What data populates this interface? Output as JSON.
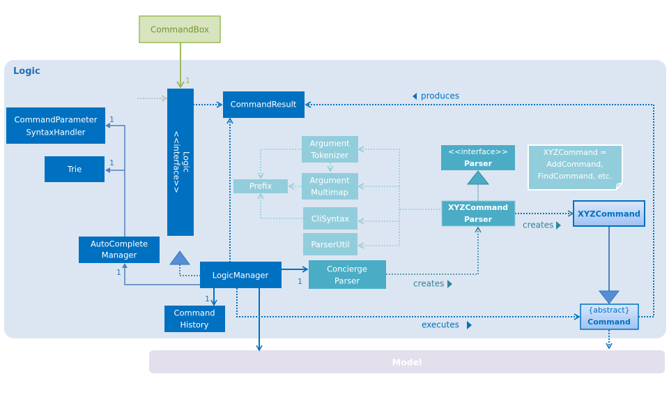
{
  "diagram": {
    "packages": {
      "logic": {
        "label": "Logic",
        "color": "#dce6f2"
      },
      "model": {
        "label": "Model",
        "color": "#e4dfec"
      }
    },
    "external": {
      "command_box": {
        "label": "CommandBox"
      }
    },
    "classes": {
      "command_parameter_syntax_handler": {
        "line1": "CommandParameter",
        "line2": "SyntaxHandler"
      },
      "trie": {
        "label": "Trie"
      },
      "autocomplete_manager": {
        "line1": "AutoComplete",
        "line2": "Manager"
      },
      "logic_interface": {
        "line1": "<<interface>>",
        "line2": "Logic"
      },
      "command_result": {
        "label": "CommandResult"
      },
      "logic_manager": {
        "label": "LogicManager"
      },
      "command_history": {
        "line1": "Command",
        "line2": "History"
      },
      "concierge_parser": {
        "line1": "Concierge",
        "line2": "Parser"
      },
      "argument_tokenizer": {
        "line1": "Argument",
        "line2": "Tokenizer"
      },
      "argument_multimap": {
        "line1": "Argument",
        "line2": "Multimap"
      },
      "prefix": {
        "label": "Prefix"
      },
      "cli_syntax": {
        "label": "CliSyntax"
      },
      "parser_util": {
        "label": "ParserUtil"
      },
      "parser_interface": {
        "line1": "<<interface>>",
        "line2": "Parser"
      },
      "xyz_command_parser": {
        "line1": "XYZCommand",
        "line2": "Parser"
      },
      "xyz_command": {
        "label": "XYZCommand"
      },
      "abstract_command": {
        "line1": "{abstract}",
        "line2": "Command"
      }
    },
    "note": {
      "line1": "XYZCommand =",
      "line2": "AddCommand,",
      "line3": "FindCommand,  etc."
    },
    "edge_labels": {
      "produces": "produces",
      "creates_xyz": "creates",
      "creates_parser": "creates",
      "executes": "executes"
    },
    "multiplicities": {
      "commandbox_logic": "1",
      "acm_cpsh": "1",
      "acm_trie": "1",
      "lm_acm": "1",
      "lm_history": "1",
      "lm_concierge": "1"
    },
    "colors": {
      "dark_blue": "#0070c0",
      "teal": "#4bacc6",
      "light_teal": "#92cddc",
      "green": "#9bbb59",
      "green_fill": "#d7e4bd",
      "green_text": "#77933c"
    }
  }
}
